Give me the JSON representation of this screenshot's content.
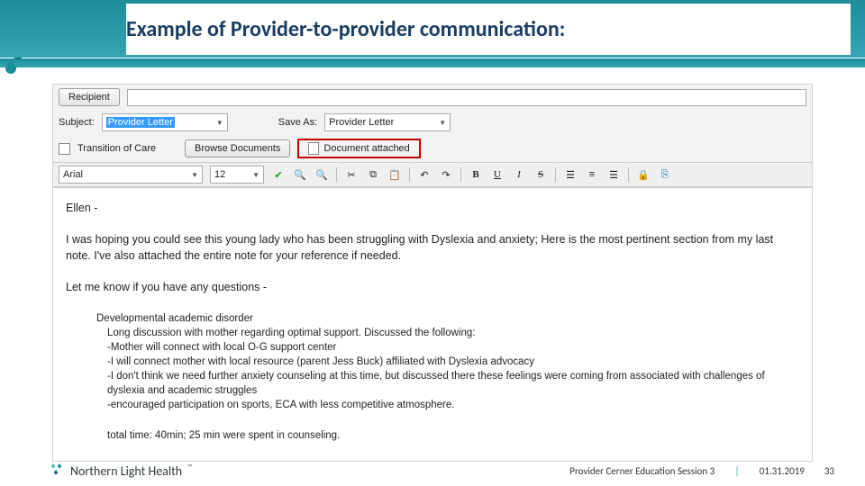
{
  "slide": {
    "title": "Example of Provider-to-provider communication:"
  },
  "form": {
    "recipient_label": "Recipient",
    "recipient_value": "",
    "subject_label": "Subject:",
    "subject_value": "Provider Letter",
    "saveas_label": "Save As:",
    "saveas_value": "Provider Letter",
    "transition_label": "Transition of Care",
    "browse_label": "Browse Documents",
    "attached_label": "Document attached"
  },
  "fmt": {
    "font": "Arial",
    "size": "12",
    "b": "B",
    "u": "U",
    "i": "I",
    "s": "S"
  },
  "letter": {
    "greeting": "Ellen -",
    "p1": "I was hoping you could see this young lady who has been struggling with Dyslexia and anxiety; Here is the most pertinent section from my last note.  I've also attached the entire note for your reference if needed.",
    "p2": "Let me know if you have any questions -",
    "dx": "Developmental academic disorder",
    "n1": "Long discussion with mother regarding optimal support.  Discussed the following:",
    "n2": "-Mother will connect with local O-G support center",
    "n3": "-I will connect mother with local resource (parent Jess Buck) affiliated with Dyslexia advocacy",
    "n4": "-I don't think we need further anxiety counseling at this time, but discussed there these feelings were coming from associated with challenges of dyslexia and academic struggles",
    "n5": "-encouraged participation on sports, ECA with less competitive atmosphere.",
    "n6": "total time: 40min; 25 min were spent in counseling."
  },
  "footer": {
    "org": "Northern Light Health",
    "session": "Provider Cerner Education Session 3",
    "date": "01.31.2019",
    "page": "33"
  }
}
